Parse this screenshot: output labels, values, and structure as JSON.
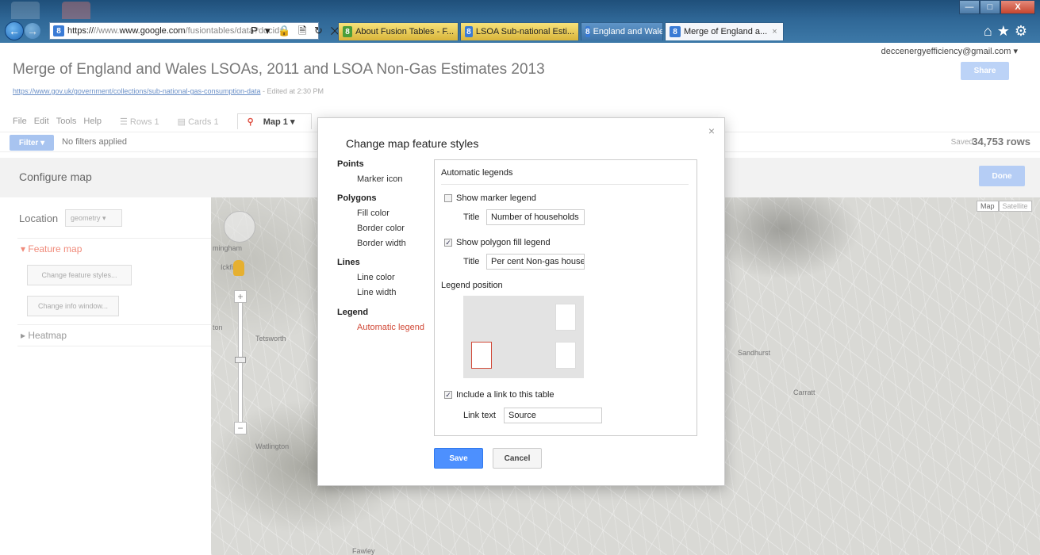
{
  "browser": {
    "url_prefix": "https://",
    "url_host": "www.google.com",
    "url_path": "/fusiontables/data?docid=",
    "url_tools": "Ρ ▾ 🔒 🗎 ↻ ✕",
    "tabs": [
      {
        "label": "About Fusion Tables - F..."
      },
      {
        "label": "LSOA Sub-national Esti..."
      },
      {
        "label": "England and Wales LS..."
      },
      {
        "label": "Merge of England a..."
      }
    ],
    "tab_close": "×",
    "window_controls": {
      "minimize": "—",
      "maximize": "□",
      "close": "X"
    },
    "toolbar_icons": "⌂★⚙"
  },
  "page": {
    "account": "deccenergyefficiency@gmail.com ▾",
    "title": "Merge of England and Wales LSOAs, 2011 and LSOA Non-Gas Estimates 2013",
    "share_label": "Share",
    "source_link": "https://www.gov.uk/government/collections/sub-national-gas-consumption-data",
    "edited": " - Edited at 2:30 PM",
    "menu": [
      "File",
      "Edit",
      "Tools",
      "Help"
    ],
    "view_tabs": [
      {
        "label": "☰ Rows 1"
      },
      {
        "label": "▤ Cards 1"
      },
      {
        "label": "Map 1 ▾"
      }
    ],
    "filter_label": "Filter ▾",
    "filters_status": "No filters applied",
    "saved": "Saved",
    "row_count": "34,753 rows"
  },
  "configure": {
    "title": "Configure map",
    "done_label": "Done",
    "location_label": "Location",
    "location_value": "geometry ▾",
    "feature_map": "▾ Feature map",
    "change_styles": "Change feature styles...",
    "change_info": "Change info window...",
    "heatmap": "▸ Heatmap"
  },
  "map": {
    "map_type": "Map",
    "satellite": "Satellite",
    "labels": [
      "mingham",
      "Ickfi",
      "ton",
      "Tetsworth",
      "Watlington",
      "Fawley",
      "Sandhurst",
      "Carratt"
    ]
  },
  "modal": {
    "title": "Change map feature styles",
    "close": "×",
    "nav": {
      "points_head": "Points",
      "marker_icon": "Marker icon",
      "polygons_head": "Polygons",
      "fill_color": "Fill color",
      "border_color": "Border color",
      "border_width": "Border width",
      "lines_head": "Lines",
      "line_color": "Line color",
      "line_width": "Line width",
      "legend_head": "Legend",
      "automatic_legend": "Automatic legend"
    },
    "pane": {
      "title": "Automatic legends",
      "show_marker": "Show marker legend",
      "marker_checked": false,
      "title_label": "Title",
      "marker_title": "Number of households",
      "show_polygon": "Show polygon fill legend",
      "polygon_checked": true,
      "polygon_title": "Per cent Non-gas house",
      "legend_position": "Legend position",
      "include_link": "Include a link to this table",
      "link_checked": true,
      "link_text_label": "Link text",
      "link_text": "Source"
    },
    "save_label": "Save",
    "cancel_label": "Cancel"
  }
}
